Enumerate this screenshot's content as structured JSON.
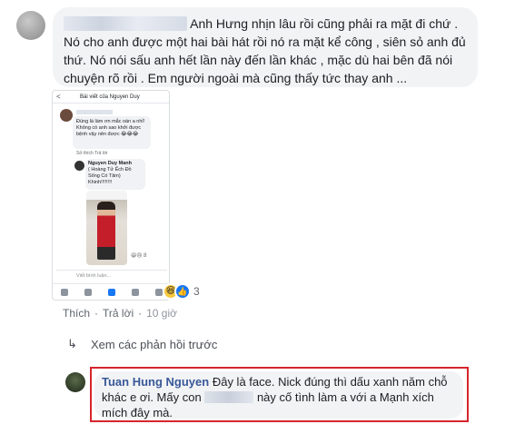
{
  "comment": {
    "text": "Anh Hưng nhịn lâu rồi cũng phải ra mặt đi chứ . Nó cho anh được một hai bài hát rồi nó ra mặt kể công , siên sỏ anh đủ thứ. Nó nói sấu anh hết lần này đến lần khác , mặc dù hai bên đã nói chuyện rõ rồi . Em người ngoài mà cũng thấy tức thay anh ..."
  },
  "screenshot": {
    "back": "<",
    "title": "Bài viết của Nguyen Duy",
    "comment1": "Đúng là làm ơn mắc oán a nhỉ! Không có anh sao khởi được bệnh vậy nên được 😂😂😂",
    "comment1_actions": "Sở thích   Trả lời",
    "commenter2": "Nguyen Duy Manh",
    "comment2": "( Hoàng Tử Ếch Đồ Sống Có Tâm) Khinh!!!!!!!!",
    "reaction_line": "😆😢 8",
    "input_placeholder": "Viết bình luận..."
  },
  "reactions": {
    "count": "3",
    "icons": [
      "haha-icon",
      "like-icon"
    ]
  },
  "actions": {
    "like": "Thích",
    "reply": "Trả lời",
    "time": "10 giờ"
  },
  "previous_replies": "Xem các phản hồi trước",
  "reply": {
    "author": "Tuan Hung Nguyen",
    "text_part1": "Đây là face. Nick đúng thì dấu xanh năm chỗ khác e ơi. Mấy con",
    "text_part2": "này cố tình làm a với a Mạnh xích mích đây mà."
  },
  "colors": {
    "accent": "#1877f2",
    "name_link": "#385898",
    "highlight_border": "#d6252c",
    "bubble_bg": "#f2f3f5"
  }
}
